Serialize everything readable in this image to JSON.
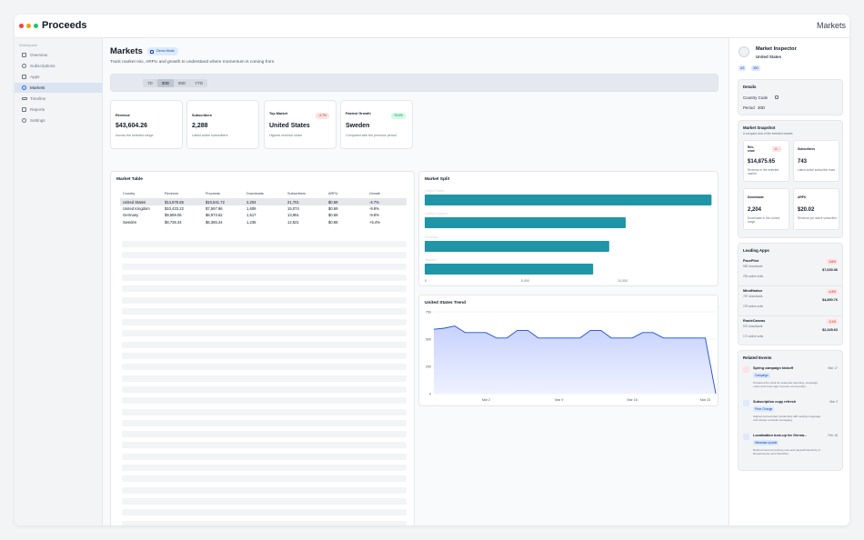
{
  "app": {
    "title": "Proceeds",
    "top_right_title": "Markets"
  },
  "sidebar": {
    "section": "Workspace",
    "items": [
      {
        "label": "Overview",
        "icon": "document-icon",
        "active": false
      },
      {
        "label": "Subscriptions",
        "icon": "refresh-icon",
        "active": false
      },
      {
        "label": "Apps",
        "icon": "grid-icon",
        "active": false
      },
      {
        "label": "Markets",
        "icon": "globe-icon",
        "active": true
      },
      {
        "label": "Timeline",
        "icon": "timeline-icon",
        "active": false
      },
      {
        "label": "Reports",
        "icon": "report-icon",
        "active": false
      },
      {
        "label": "Settings",
        "icon": "gear-icon",
        "active": false
      }
    ]
  },
  "header": {
    "title": "Markets",
    "badge": "Demo Mode",
    "subtitle": "Track market mix, ARPU and growth to understand where momentum is coming from."
  },
  "ranges": {
    "options": [
      "7D",
      "30D",
      "90D",
      "YTD"
    ],
    "selected": "30D"
  },
  "kpis": [
    {
      "label": "Revenue",
      "value": "$43,604.26",
      "note": "Across the selected range",
      "delta": ""
    },
    {
      "label": "Subscribers",
      "value": "2,288",
      "note": "Latest active subscribers",
      "delta": ""
    },
    {
      "label": "Top Market",
      "value": "United States",
      "note": "Highest revenue share",
      "delta": "-4.7%",
      "delta_type": "neg"
    },
    {
      "label": "Fastest Growth",
      "value": "Sweden",
      "note": "Compared with the previous period",
      "delta": "+5.4%",
      "delta_type": "pos"
    }
  ],
  "market_table": {
    "title": "Market Table",
    "columns": [
      "Country",
      "Revenue",
      "Proceeds",
      "Downloads",
      "Subscribers",
      "ARPU",
      "Growth"
    ],
    "rows": [
      [
        "United States",
        "$14,875.65",
        "$10,841.72",
        "2,204",
        "21,701",
        "$0.69",
        "-4.7%"
      ],
      [
        "United Kingdom",
        "$10,423.22",
        "$7,597.96",
        "1,609",
        "15,074",
        "$0.69",
        "-9.9%"
      ],
      [
        "Germany",
        "$9,569.05",
        "$6,973.62",
        "1,517",
        "13,951",
        "$0.69",
        "-9.8%"
      ],
      [
        "Sweden",
        "$8,736.34",
        "$6,365.24",
        "1,236",
        "12,821",
        "$0.68",
        "+5.4%"
      ]
    ],
    "selected_row": 0
  },
  "market_split": {
    "title": "Market Split",
    "accent": "#1f95a8",
    "chart_data": {
      "type": "bar",
      "orientation": "horizontal",
      "categories": [
        "United States",
        "United Kingdom",
        "Germany",
        "Sweden"
      ],
      "values": [
        14875.65,
        10423.22,
        9569.05,
        8736.34
      ],
      "xlim": [
        0,
        15000
      ],
      "ticks": [
        "0",
        "5,000",
        "10,000"
      ]
    }
  },
  "trend": {
    "title": "United States Trend",
    "chart_data": {
      "type": "area",
      "y_ticks": [
        "750",
        "500",
        "250",
        "0"
      ],
      "ylim": [
        0,
        750
      ],
      "x_ticks": [
        "Mar 2",
        "Mar 9",
        "Mar 16",
        "Mar 23"
      ],
      "values": [
        590,
        600,
        620,
        560,
        560,
        560,
        510,
        510,
        580,
        580,
        510,
        510,
        510,
        510,
        510,
        580,
        580,
        510,
        510,
        510,
        560,
        560,
        510,
        510,
        510,
        510,
        510,
        0
      ]
    }
  },
  "inspector": {
    "title": "Market Inspector",
    "subtitle": "United States",
    "chips": [
      "US",
      "30D"
    ],
    "details": {
      "title": "Details",
      "country_code_label": "Country Code",
      "period_label": "Period",
      "period_value": "30D"
    },
    "snapshot": {
      "title": "Market Snapshot",
      "subtitle": "A compact view of the selected market.",
      "cards": [
        {
          "label": "Rev-\nenue",
          "value": "$14,875.65",
          "note": "Revenue in the selected market",
          "delta": "-4..."
        },
        {
          "label": "Subscribers",
          "value": "743",
          "note": "Latest active subscriber base",
          "delta": ""
        },
        {
          "label": "Downloads",
          "value": "2,204",
          "note": "Downloads in the current range",
          "delta": ""
        },
        {
          "label": "ARPU",
          "value": "$20.02",
          "note": "Revenue per active subscriber",
          "delta": ""
        }
      ]
    },
    "leading_apps": {
      "title": "Leading Apps",
      "apps": [
        {
          "name": "PacePilot",
          "downloads": "982 downloads",
          "revenue": "$7,639.36",
          "subs": "294 active subs",
          "delta": "-3.6%"
        },
        {
          "name": "MindHarbor",
          "downloads": "787 downloads",
          "revenue": "$4,890.76",
          "subs": "278 active subs",
          "delta": "-4.4%"
        },
        {
          "name": "RouteCanvas",
          "downloads": "570 downloads",
          "revenue": "$2,345.63",
          "subs": "171 active subs",
          "delta": "-3.1%"
        }
      ]
    },
    "events": {
      "title": "Related Events",
      "items": [
        {
          "title": "Spring campaign kickoff",
          "date": "Mar 17",
          "tag": "Campaign",
          "desc": "Prepared the shell for seasonal reporting, campaign notes and cross-app revenue commentary.",
          "color": "#fee2e2"
        },
        {
          "title": "Subscription copy refresh",
          "date": "Mar 3",
          "tag": "Price Change",
          "desc": "Aligned annual plan positioning with savings language and clearer renewal messaging.",
          "color": "#dbeafe"
        },
        {
          "title": "Localization tune-up for Germa...",
          "date": "Feb 18",
          "tag": "Metadata Update",
          "desc": "Refined German pricing cues and paywall hierarchy in RouteCanvas and PacePilot.",
          "color": "#e0e7ff"
        }
      ]
    }
  }
}
